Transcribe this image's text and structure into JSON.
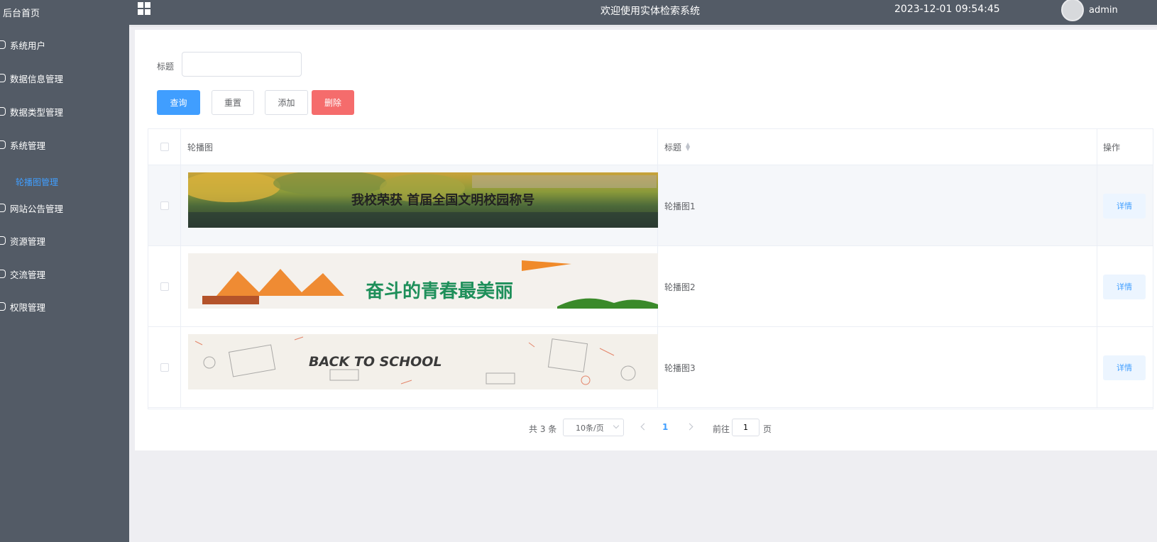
{
  "sidebar": {
    "home": "后台首页",
    "items": [
      {
        "label": "系统用户"
      },
      {
        "label": "数据信息管理"
      },
      {
        "label": "数据类型管理"
      },
      {
        "label": "系统管理"
      },
      {
        "label": "网站公告管理"
      },
      {
        "label": "资源管理"
      },
      {
        "label": "交流管理"
      },
      {
        "label": "权限管理"
      }
    ],
    "active_sub": "轮播图管理"
  },
  "topbar": {
    "title": "欢迎使用实体检索系统",
    "time": "2023-12-01 09:54:45",
    "username": "admin"
  },
  "search": {
    "label": "标题",
    "value": "",
    "placeholder": ""
  },
  "buttons": {
    "query": "查询",
    "reset": "重置",
    "add": "添加",
    "delete": "删除"
  },
  "table": {
    "headers": {
      "image": "轮播图",
      "title": "标题",
      "op": "操作"
    },
    "rows": [
      {
        "title": "轮播图1",
        "op": "详情",
        "banner_text": "我校荣获 首届全国文明校园称号"
      },
      {
        "title": "轮播图2",
        "op": "详情",
        "banner_text": "奋斗的青春最美丽"
      },
      {
        "title": "轮播图3",
        "op": "详情",
        "banner_text": "BACK TO SCHOOL"
      }
    ]
  },
  "pagination": {
    "total": "共 3 条",
    "page_size": "10条/页",
    "current_page": "1",
    "goto_label": "前往",
    "goto_value": "1",
    "goto_suffix": "页"
  },
  "colors": {
    "sidebar_bg": "#535b66",
    "primary": "#409eff",
    "danger": "#f56c6c"
  }
}
